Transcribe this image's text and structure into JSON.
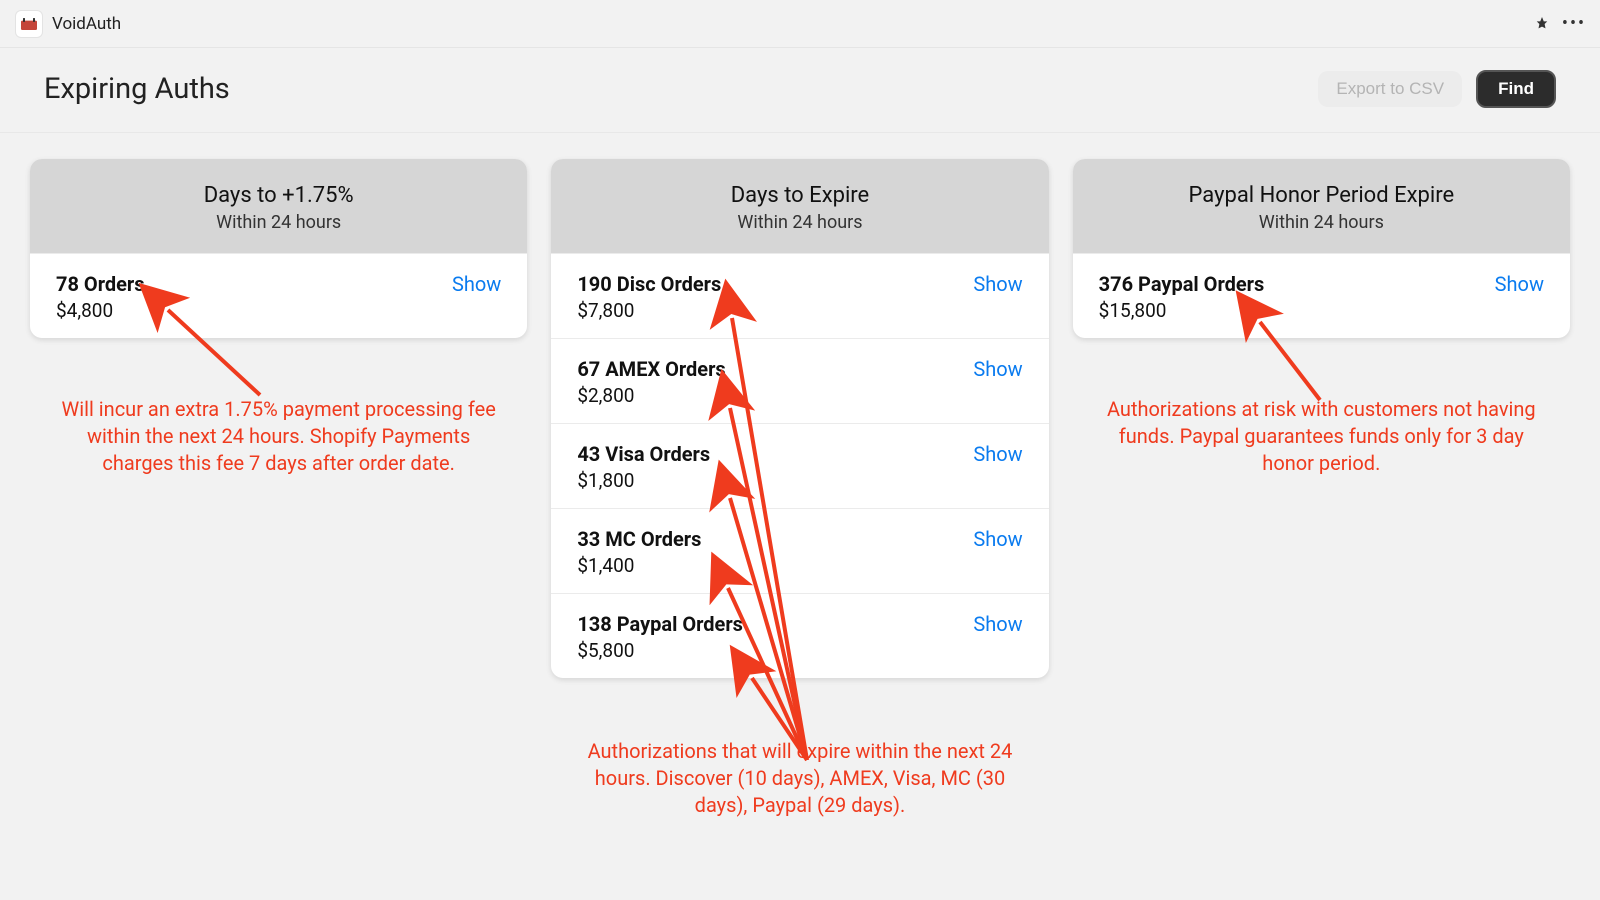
{
  "app": {
    "name": "VoidAuth"
  },
  "header": {
    "title": "Expiring Auths",
    "export_label": "Export to CSV",
    "find_label": "Find"
  },
  "columns": [
    {
      "title": "Days to +1.75%",
      "sub": "Within 24 hours",
      "rows": [
        {
          "title": "78 Orders",
          "amount": "$4,800",
          "link": "Show"
        }
      ],
      "annotation": "Will incur an extra 1.75% payment processing fee within the next 24 hours.  Shopify Payments charges this fee 7 days after order date."
    },
    {
      "title": "Days to Expire",
      "sub": "Within 24 hours",
      "rows": [
        {
          "title": "190 Disc Orders",
          "amount": "$7,800",
          "link": "Show"
        },
        {
          "title": "67 AMEX Orders",
          "amount": "$2,800",
          "link": "Show"
        },
        {
          "title": "43 Visa Orders",
          "amount": "$1,800",
          "link": "Show"
        },
        {
          "title": "33 MC Orders",
          "amount": "$1,400",
          "link": "Show"
        },
        {
          "title": "138 Paypal Orders",
          "amount": "$5,800",
          "link": "Show"
        }
      ],
      "annotation": "Authorizations that will expire within the next 24 hours.  Discover (10 days), AMEX, Visa, MC (30 days), Paypal (29 days)."
    },
    {
      "title": "Paypal Honor Period Expire",
      "sub": "Within 24 hours",
      "rows": [
        {
          "title": "376 Paypal Orders",
          "amount": "$15,800",
          "link": "Show"
        }
      ],
      "annotation": "Authorizations at risk with customers not having funds.  Paypal guarantees funds only for 3 day honor period."
    }
  ]
}
